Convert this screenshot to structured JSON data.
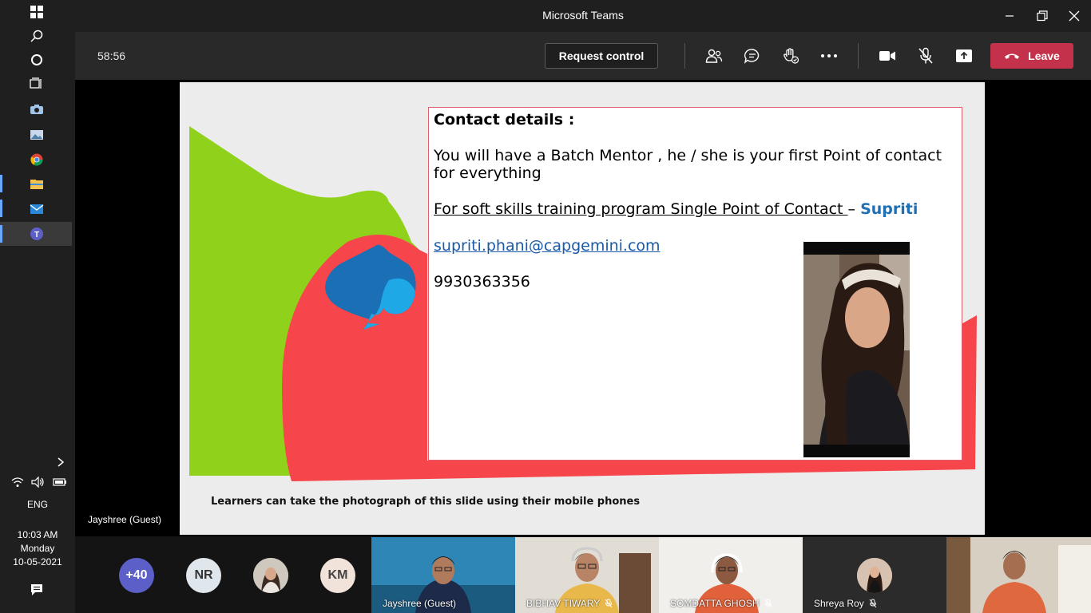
{
  "window": {
    "title": "Microsoft Teams"
  },
  "call": {
    "timer": "58:56",
    "request_control_label": "Request control",
    "leave_label": "Leave"
  },
  "system": {
    "language": "ENG",
    "time": "10:03 AM",
    "day": "Monday",
    "date": "10-05-2021"
  },
  "stage": {
    "presenter_name": "Jayshree (Guest)"
  },
  "slide": {
    "heading": "Contact details :",
    "mentor_text": "You will have a Batch Mentor , he / she is your first Point of contact for everything",
    "spoc_text": "For soft skills training program Single Point of Contact ",
    "spoc_dash": " – ",
    "spoc_name": "Supriti",
    "email": "supriti.phani@capgemini.com",
    "phone": "9930363356",
    "footnote": "Learners can take the photograph of this slide using their mobile phones"
  },
  "participants": {
    "more_count": "+40",
    "avatars": [
      {
        "initials": "NR",
        "color": "#dfe6ec",
        "text_color": "#333"
      },
      {
        "initials": "KM",
        "color": "#f1e2da",
        "text_color": "#444"
      }
    ],
    "tiles": [
      {
        "name": "Jayshree (Guest)"
      },
      {
        "name": "BIBHAV TIWARY"
      },
      {
        "name": "SOMDATTA GHOSH"
      },
      {
        "name": "Shreya Roy"
      }
    ]
  },
  "colors": {
    "leave_red": "#c4314b",
    "accent_green": "#8fd11b",
    "accent_red": "#f6464b",
    "spade_blue": "#1a6fb5",
    "spade_light": "#1fa8e6"
  }
}
